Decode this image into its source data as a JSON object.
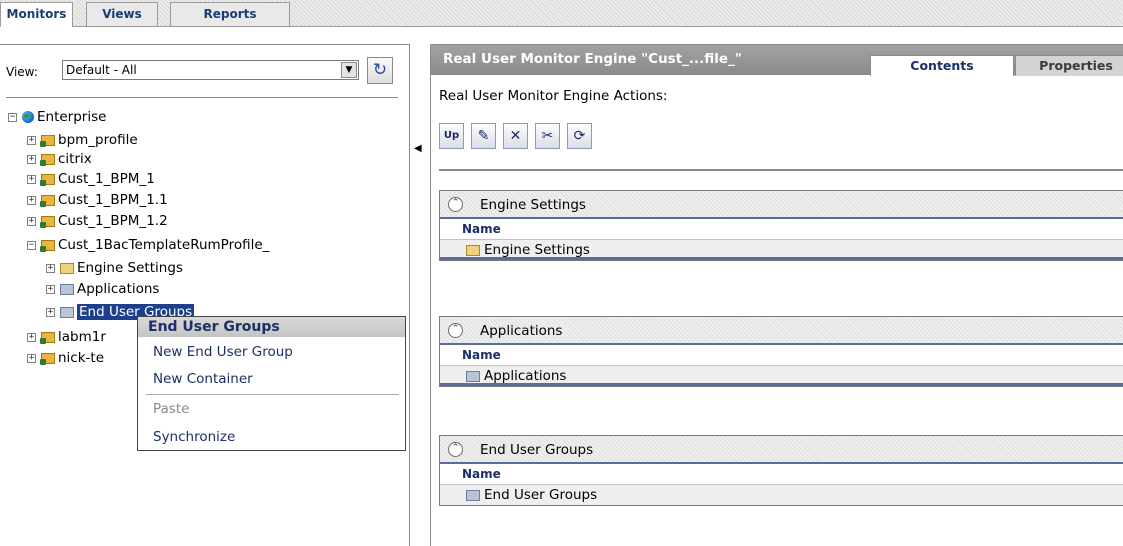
{
  "top_tabs": [
    "Monitors",
    "Views",
    "Reports"
  ],
  "left": {
    "view_label": "View:",
    "view_value": "Default - All",
    "refresh_icon": "refresh-icon",
    "tree": [
      {
        "label": "Enterprise",
        "expander": "−",
        "icon": "globe-icon"
      },
      {
        "label": "bpm_profile",
        "expander": "+",
        "icon": "profile-folder-icon"
      },
      {
        "label": "citrix",
        "expander": "+",
        "icon": "profile-folder-icon"
      },
      {
        "label": "Cust_1_BPM_1",
        "expander": "+",
        "icon": "profile-folder-icon"
      },
      {
        "label": "Cust_1_BPM_1.1",
        "expander": "+",
        "icon": "profile-folder-icon"
      },
      {
        "label": "Cust_1_BPM_1.2",
        "expander": "+",
        "icon": "profile-folder-icon"
      },
      {
        "label": "Cust_1BacTemplateRumProfile_",
        "expander": "−",
        "icon": "rum-profile-icon"
      },
      {
        "label": "Engine Settings",
        "expander": "+",
        "icon": "settings-folder-icon"
      },
      {
        "label": "Applications",
        "expander": "+",
        "icon": "folder-icon"
      },
      {
        "label": "End User Groups",
        "expander": "+",
        "icon": "folder-icon"
      },
      {
        "label": "labm1r",
        "expander": "+",
        "icon": "rum-profile-icon"
      },
      {
        "label": "nick-te",
        "expander": "+",
        "icon": "rum-profile-icon"
      }
    ]
  },
  "context_menu": {
    "title": "End User Groups",
    "items": [
      "New End User Group",
      "New Container",
      "Paste",
      "Synchronize"
    ]
  },
  "right": {
    "title": "Real User Monitor Engine \"Cust_...file_\"",
    "tabs": [
      "Contents",
      "Properties"
    ],
    "actions_label": "Real User Monitor Engine Actions:",
    "toolbar": {
      "up_label": "Up",
      "icons": [
        "edit-icon",
        "delete-icon",
        "cut-icon",
        "synchronize-icon"
      ]
    },
    "column_header": "Name",
    "sections": [
      {
        "title": "Engine Settings",
        "row": "Engine Settings"
      },
      {
        "title": "Applications",
        "row": "Applications"
      },
      {
        "title": "End User Groups",
        "row": "End User Groups"
      }
    ]
  }
}
